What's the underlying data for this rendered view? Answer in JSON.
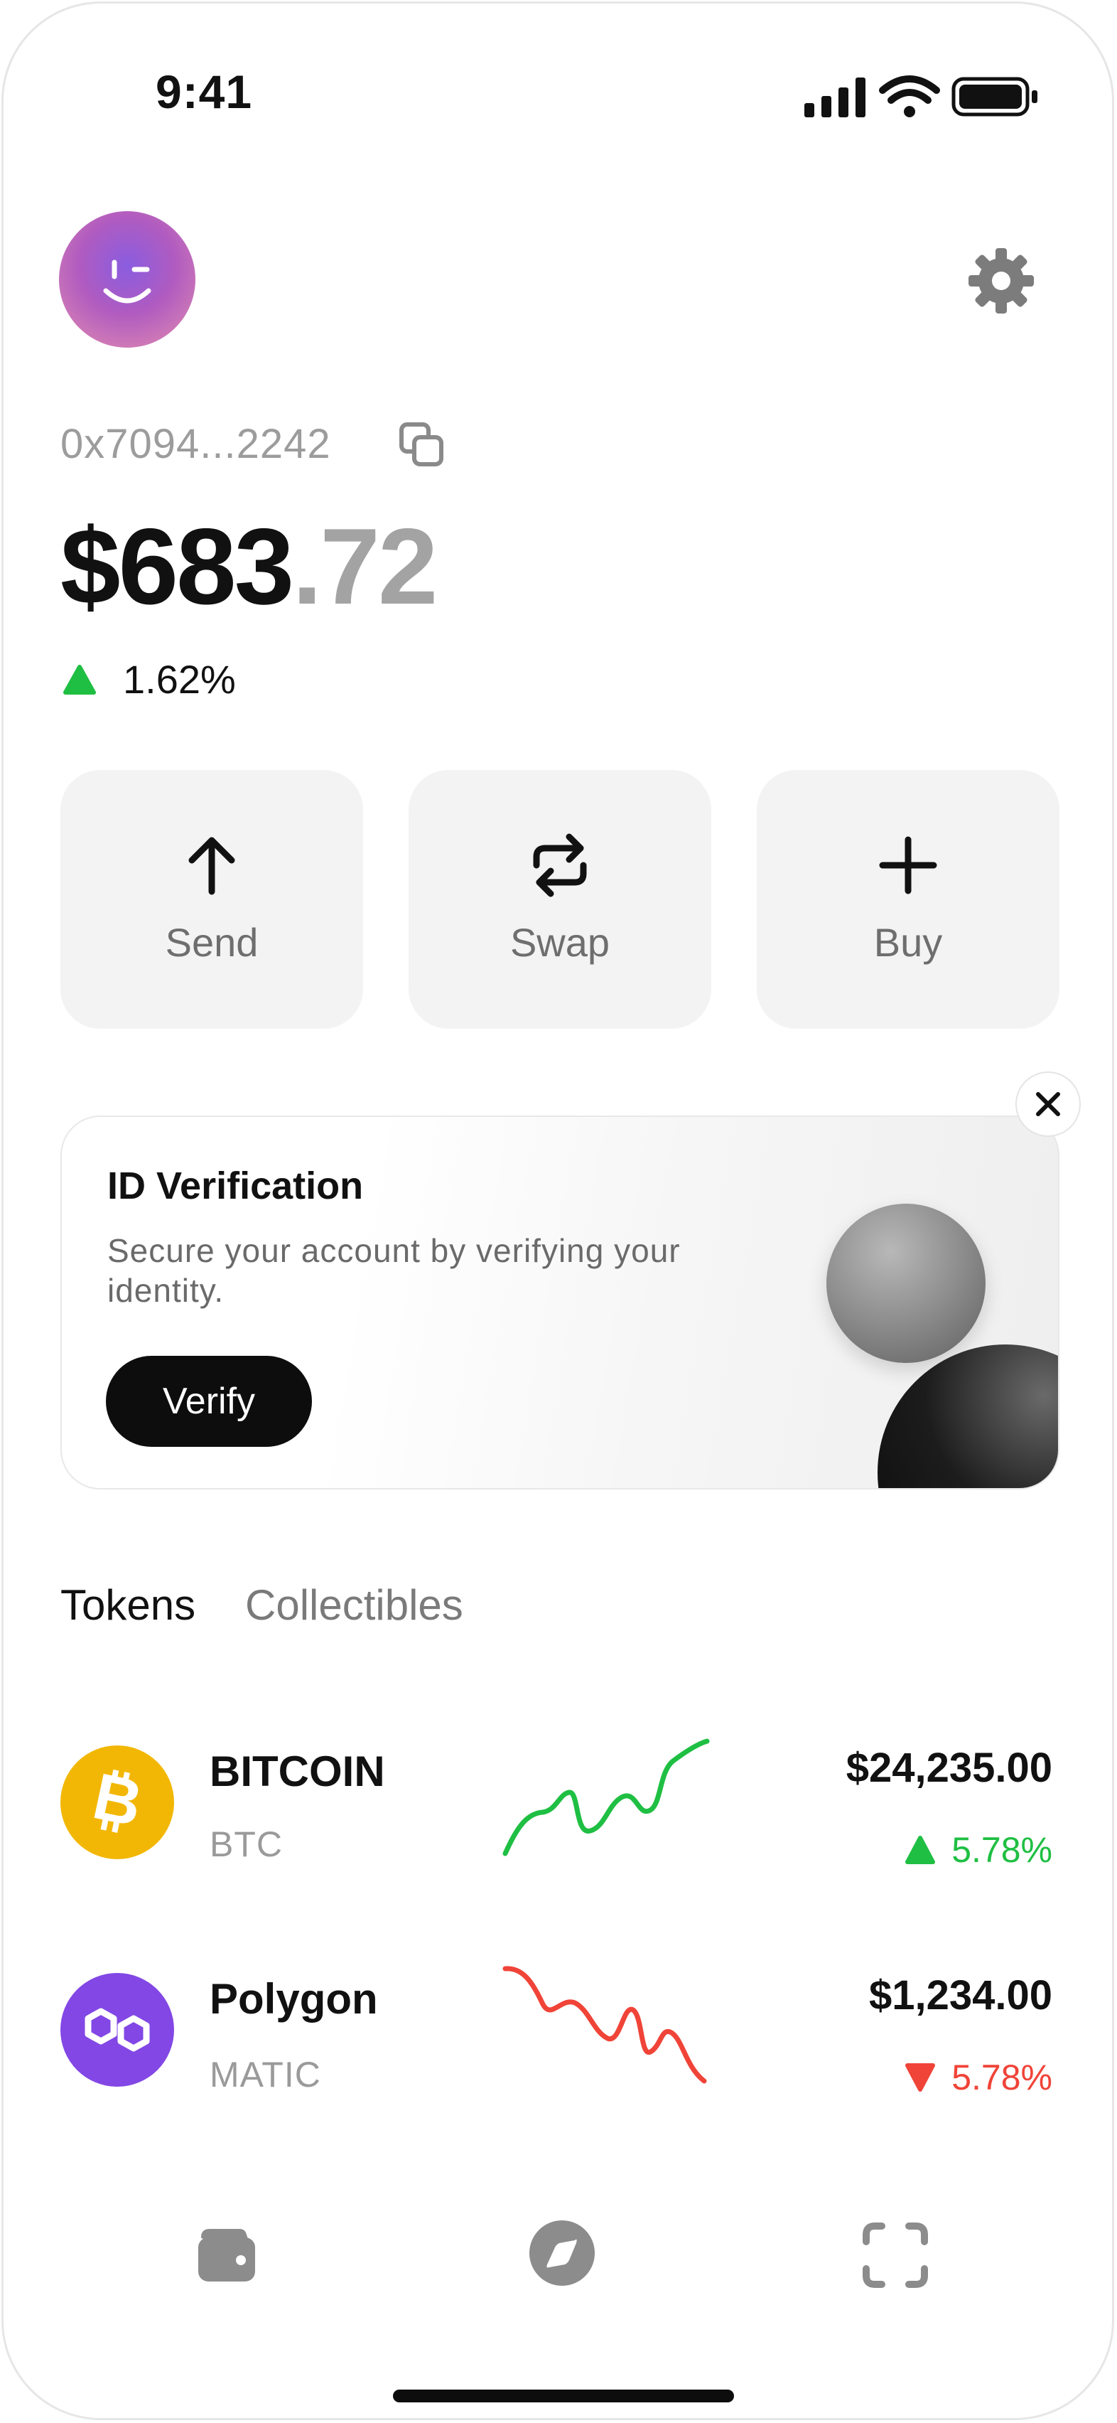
{
  "status_bar": {
    "time": "9:41"
  },
  "wallet": {
    "address": "0x7094...2242",
    "balance_whole": "$683",
    "balance_decimal": ".72",
    "change_percent": "1.62%"
  },
  "actions": [
    {
      "label": "Send",
      "icon": "arrow-up-icon"
    },
    {
      "label": "Swap",
      "icon": "swap-icon"
    },
    {
      "label": "Buy",
      "icon": "plus-icon"
    }
  ],
  "banner": {
    "title": "ID Verification",
    "description": "Secure your account by verifying your identity.",
    "button_label": "Verify"
  },
  "tabs": {
    "active": "Tokens",
    "inactive": "Collectibles"
  },
  "tokens": [
    {
      "name": "BITCOIN",
      "symbol": "BTC",
      "price": "$24,235.00",
      "change": "5.78%",
      "direction": "up",
      "color": "#f2b705",
      "trend_color": "#1fbf43"
    },
    {
      "name": "Polygon",
      "symbol": "MATIC",
      "price": "$1,234.00",
      "change": "5.78%",
      "direction": "down",
      "color": "#8247e5",
      "trend_color": "#f04438"
    }
  ],
  "bottom_nav": [
    {
      "icon": "wallet-icon"
    },
    {
      "icon": "compass-icon"
    },
    {
      "icon": "scan-icon"
    }
  ],
  "colors": {
    "positive": "#1fbf43",
    "negative": "#f04438",
    "muted": "#9c9c9c"
  }
}
